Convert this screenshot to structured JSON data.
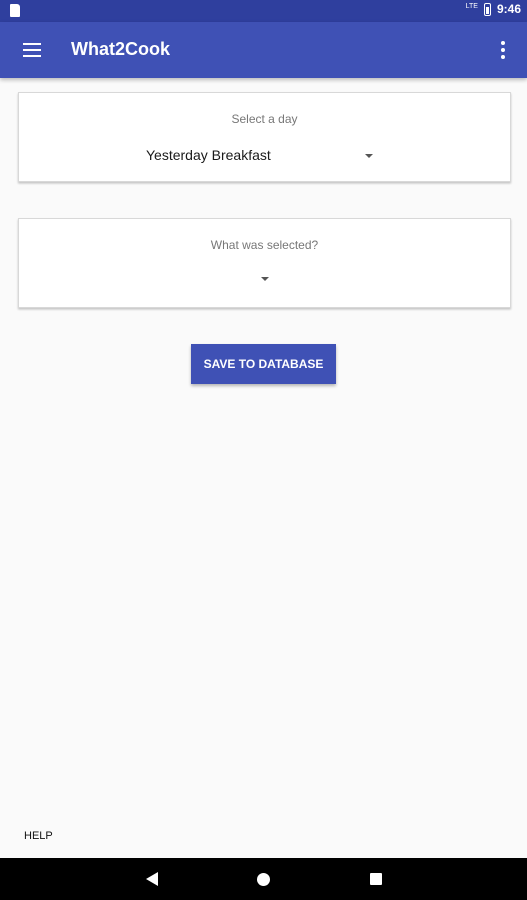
{
  "status_bar": {
    "network": "LTE",
    "time": "9:46"
  },
  "app_bar": {
    "title": "What2Cook"
  },
  "day_card": {
    "label": "Select a day",
    "selected_value": "Yesterday Breakfast"
  },
  "selection_card": {
    "label": "What was selected?",
    "selected_value": ""
  },
  "actions": {
    "save_label": "SAVE TO DATABASE",
    "help_label": "HELP"
  },
  "colors": {
    "primary": "#3f51b5",
    "primary_dark": "#2f3f9e",
    "background": "#fafafa"
  },
  "icons": {
    "status": [
      "sd-card-icon",
      "lte-icon",
      "battery-icon"
    ],
    "app_bar": [
      "menu-icon",
      "overflow-menu-icon"
    ],
    "nav": [
      "back-icon",
      "home-icon",
      "recents-icon"
    ]
  }
}
